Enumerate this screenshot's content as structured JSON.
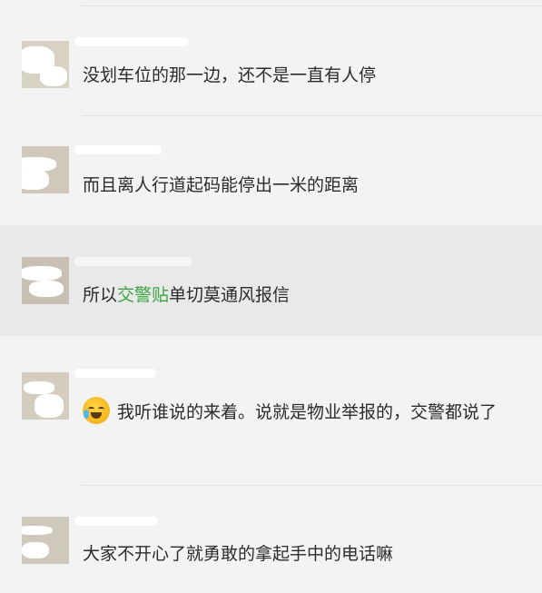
{
  "comments": [
    {
      "sender": "",
      "text": "没划车位的那一边，还不是一直有人停"
    },
    {
      "sender": "",
      "text": "而且离人行道起码能停出一米的距离"
    },
    {
      "sender": "",
      "text_before": "所以",
      "link_text": "交警贴",
      "text_after": "单切莫通风报信",
      "link_color": "#3aa542"
    },
    {
      "sender": "",
      "emoji": "crying-laughing-emoji",
      "text": "我听谁说的来着。说就是物业举报的，交警都说了"
    },
    {
      "sender": "",
      "text": "大家不开心了就勇敢的拿起手中的电话嘛"
    }
  ]
}
